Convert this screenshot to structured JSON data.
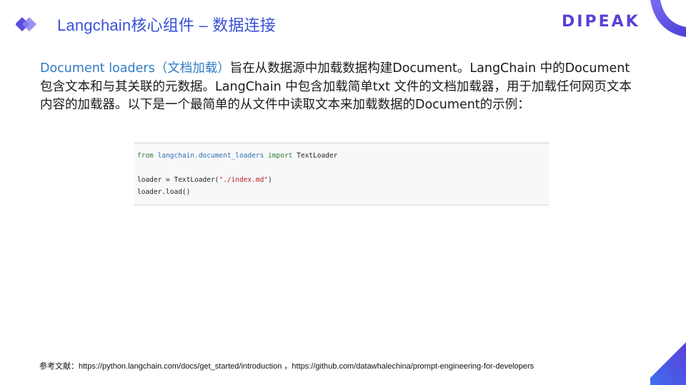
{
  "header": {
    "title": "Langchain核心组件 – 数据连接",
    "brand": "DIPEAK",
    "colors": {
      "accent": "#3b50d8",
      "brand": "#5b3fd6",
      "highlight": "#2f7ac6"
    }
  },
  "intro": {
    "term": "Document loaders（文档加载）",
    "text": "旨在从数据源中加载数据构建Document。LangChain 中的Document包含文本和与其关联的元数据。LangChain 中包含加载简单txt 文件的文档加载器，用于加载任何网页文本内容的加载器。以下是一个最简单的从文件中读取文本来加载数据的Document的示例："
  },
  "code": {
    "line1": {
      "kw_from": "from",
      "module": "langchain.document_loaders",
      "kw_import": "import",
      "name": "TextLoader"
    },
    "line2": {
      "prefix": "loader = TextLoader(",
      "string": "\"./index.md\"",
      "suffix": ")"
    },
    "line3": "loader.load()"
  },
  "footer": {
    "text": "参考文献：https://python.langchain.com/docs/get_started/introduction ，https://github.com/datawhalechina/prompt-engineering-for-developers"
  },
  "icons": [
    "logo-diamond-icon",
    "corner-decoration"
  ]
}
